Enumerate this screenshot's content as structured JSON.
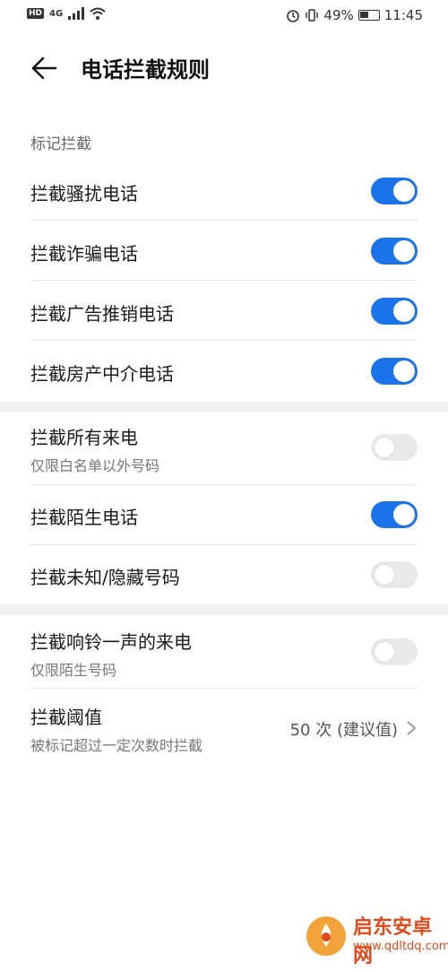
{
  "status_bar": {
    "left_label": "HD",
    "network": "4G",
    "battery_pct": "49%",
    "battery_level": 0.49,
    "time": "11:45"
  },
  "header": {
    "title": "电话拦截规则"
  },
  "sections": {
    "marked_label": "标记拦截"
  },
  "rows": [
    {
      "label": "拦截骚扰电话",
      "sub": "",
      "toggle": true
    },
    {
      "label": "拦截诈骗电话",
      "sub": "",
      "toggle": true
    },
    {
      "label": "拦截广告推销电话",
      "sub": "",
      "toggle": true
    },
    {
      "label": "拦截房产中介电话",
      "sub": "",
      "toggle": true
    },
    {
      "label": "拦截所有来电",
      "sub": "仅限白名单以外号码",
      "toggle": false
    },
    {
      "label": "拦截陌生电话",
      "sub": "",
      "toggle": true
    },
    {
      "label": "拦截未知/隐藏号码",
      "sub": "",
      "toggle": false
    },
    {
      "label": "拦截响铃一声的来电",
      "sub": "仅限陌生号码",
      "toggle": false
    }
  ],
  "threshold": {
    "label": "拦截阈值",
    "sub": "被标记超过一定次数时拦截",
    "value": "50 次 (建议值)"
  },
  "watermark": {
    "brand": "启东安卓网",
    "url": "www.qdltdq.com"
  },
  "colors": {
    "accent": "#1a73e8",
    "toggle_off": "#e9e9e9"
  }
}
